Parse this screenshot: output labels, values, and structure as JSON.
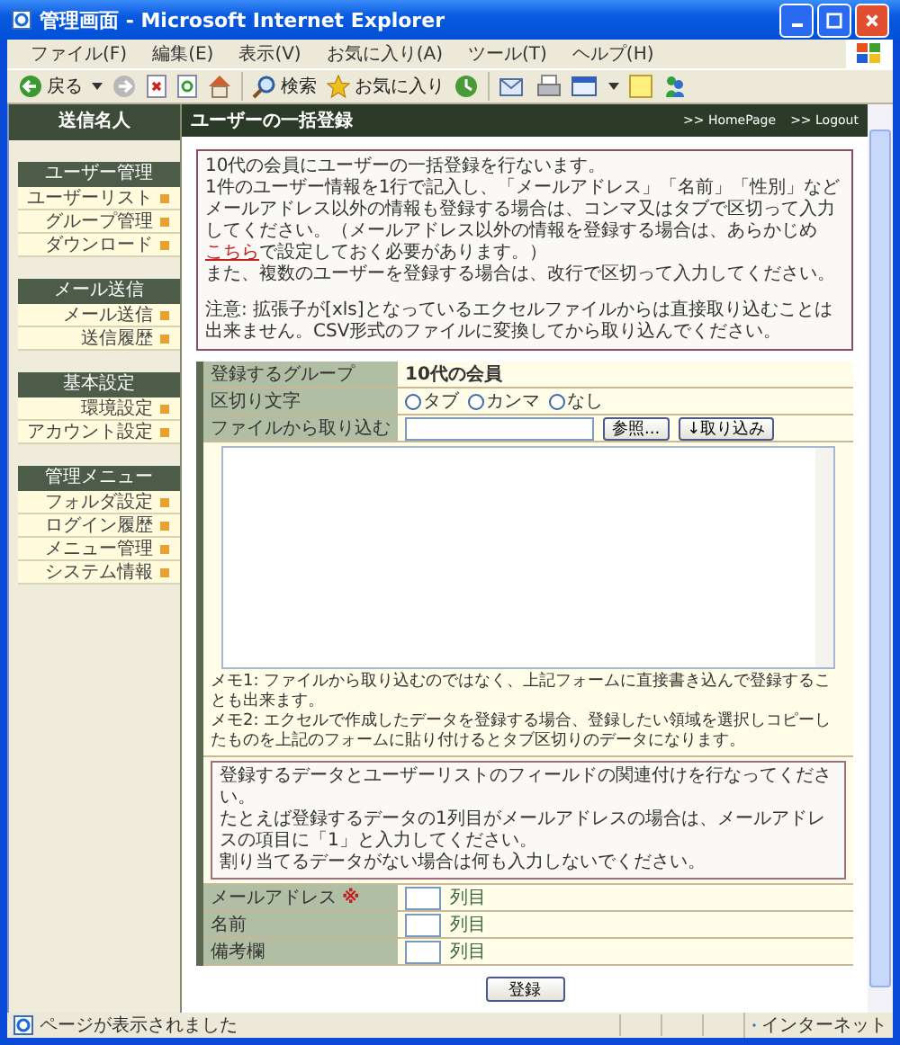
{
  "window": {
    "title": "管理画面 - Microsoft Internet Explorer"
  },
  "menu": [
    {
      "label": "ファイル(F)"
    },
    {
      "label": "編集(E)"
    },
    {
      "label": "表示(V)"
    },
    {
      "label": "お気に入り(A)"
    },
    {
      "label": "ツール(T)"
    },
    {
      "label": "ヘルプ(H)"
    }
  ],
  "toolbar": {
    "back": "戻る",
    "search": "検索",
    "favorites": "お気に入り"
  },
  "sidebar": {
    "title": "送信名人",
    "sections": [
      {
        "title": "ユーザー管理",
        "items": [
          {
            "label": "ユーザーリスト"
          },
          {
            "label": "グループ管理"
          },
          {
            "label": "ダウンロード"
          }
        ]
      },
      {
        "title": "メール送信",
        "items": [
          {
            "label": "メール送信"
          },
          {
            "label": "送信履歴"
          }
        ]
      },
      {
        "title": "基本設定",
        "items": [
          {
            "label": "環境設定"
          },
          {
            "label": "アカウント設定"
          }
        ]
      },
      {
        "title": "管理メニュー",
        "items": [
          {
            "label": "フォルダ設定"
          },
          {
            "label": "ログイン履歴"
          },
          {
            "label": "メニュー管理"
          },
          {
            "label": "システム情報"
          }
        ]
      }
    ]
  },
  "header": {
    "title": "ユーザーの一括登録",
    "links": [
      ">> HomePage",
      ">> Logout"
    ]
  },
  "intro": {
    "line_1": "10代の会員にユーザーの一括登録を行ないます。",
    "line_2_before": "1件のユーザー情報を1行で記入し、「メールアドレス」「名前」「性別」などメールアドレス以外の情報も登録する場合は、コンマ又はタブで区切って入力してください。（メールアドレス以外の情報を登録する場合は、あらかじめ",
    "link": "こちら",
    "line_2_after": "で設定しておく必要があります。）",
    "line_3": "また、複数のユーザーを登録する場合は、改行で区切って入力してください。",
    "notice": "注意: 拡張子が[xls]となっているエクセルファイルからは直接取り込むことは出来ません。CSV形式のファイルに変換してから取り込んでください。"
  },
  "form": {
    "group_label": "登録するグループ",
    "group_value": "10代の会員",
    "separator_label": "区切り文字",
    "separators": [
      {
        "label": "タブ",
        "selected": false
      },
      {
        "label": "カンマ",
        "selected": false
      },
      {
        "label": "なし",
        "selected": false
      }
    ],
    "file_label": "ファイルから取り込む",
    "browse": "参照...",
    "import": "↓取り込み",
    "memos": [
      "メモ1: ファイルから取り込むのではなく、上記フォームに直接書き込んで登録することも出来ます。",
      "メモ2: エクセルで作成したデータを登録する場合、登録したい領域を選択しコピーしたものを上記のフォームに貼り付けるとタブ区切りのデータになります。"
    ],
    "mapping_note": [
      "登録するデータとユーザーリストのフィールドの関連付けを行なってください。",
      "たとえば登録するデータの1列目がメールアドレスの場合は、メールアドレスの項目に「1」と入力してください。",
      "割り当てるデータがない場合は何も入力しないでください。"
    ],
    "fields": [
      {
        "label": "メールアドレス",
        "mark": "※",
        "suffix": "列目"
      },
      {
        "label": "名前",
        "suffix": "列目"
      },
      {
        "label": "備考欄",
        "suffix": "列目"
      }
    ],
    "submit": "登録"
  },
  "status_bar": {
    "text": "ページが表示されました",
    "zone": "インターネット"
  }
}
